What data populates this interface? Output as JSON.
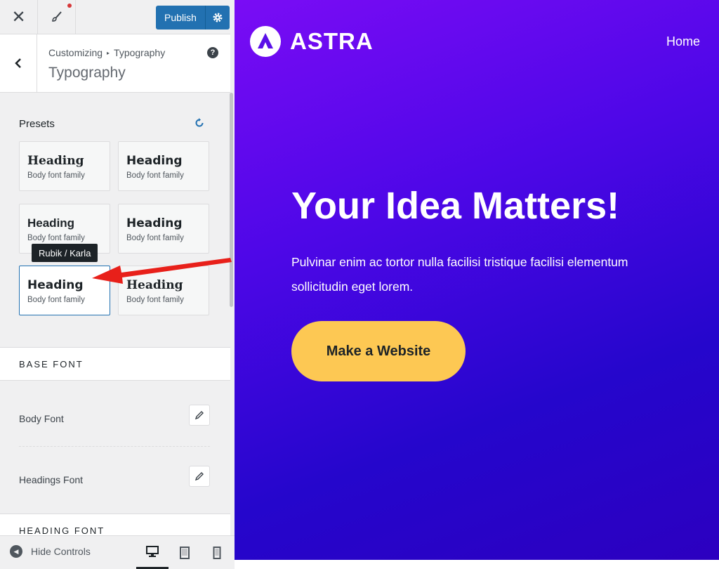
{
  "topbar": {
    "close_icon": "close-icon",
    "brush_icon": "paintbrush-icon",
    "publish_label": "Publish",
    "settings_icon": "gear-icon"
  },
  "section": {
    "breadcrumb_parent": "Customizing",
    "breadcrumb_current": "Typography",
    "title": "Typography",
    "help_symbol": "?"
  },
  "presets": {
    "label": "Presets",
    "tooltip": "Rubik / Karla",
    "items": [
      {
        "heading": "Heading",
        "body": "Body font family"
      },
      {
        "heading": "Heading",
        "body": "Body font family"
      },
      {
        "heading": "Heading",
        "body": "Body font family"
      },
      {
        "heading": "Heading",
        "body": "Body font family"
      },
      {
        "heading": "Heading",
        "body": "Body font family",
        "selected": true
      },
      {
        "heading": "Heading",
        "body": "Body font family"
      }
    ]
  },
  "base_font": {
    "group_label": "BASE FONT",
    "body_font_label": "Body Font",
    "headings_font_label": "Headings Font"
  },
  "heading_font": {
    "group_label": "HEADING FONT"
  },
  "footer": {
    "hide_controls_label": "Hide Controls",
    "devices": [
      "desktop",
      "tablet",
      "mobile"
    ]
  },
  "preview": {
    "logo_text": "ASTRA",
    "nav_home": "Home",
    "hero_title": "Your Idea Matters!",
    "hero_text": "Pulvinar enim ac tortor nulla facilisi tristique facilisi elementum sollicitudin eget lorem.",
    "cta_label": "Make a Website",
    "colors": {
      "gradient_start": "#7a0cf5",
      "gradient_end": "#2c00c0",
      "cta": "#fdc853",
      "accent_blue": "#2271b1",
      "annotation_red": "#e8201a"
    }
  }
}
